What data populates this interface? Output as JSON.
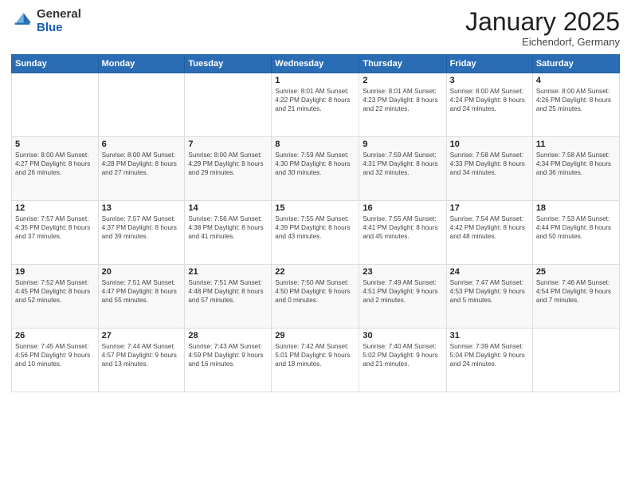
{
  "logo": {
    "general": "General",
    "blue": "Blue"
  },
  "header": {
    "title": "January 2025",
    "subtitle": "Eichendorf, Germany"
  },
  "days_of_week": [
    "Sunday",
    "Monday",
    "Tuesday",
    "Wednesday",
    "Thursday",
    "Friday",
    "Saturday"
  ],
  "weeks": [
    [
      {
        "day": "",
        "text": ""
      },
      {
        "day": "",
        "text": ""
      },
      {
        "day": "",
        "text": ""
      },
      {
        "day": "1",
        "text": "Sunrise: 8:01 AM\nSunset: 4:22 PM\nDaylight: 8 hours and 21 minutes."
      },
      {
        "day": "2",
        "text": "Sunrise: 8:01 AM\nSunset: 4:23 PM\nDaylight: 8 hours and 22 minutes."
      },
      {
        "day": "3",
        "text": "Sunrise: 8:00 AM\nSunset: 4:24 PM\nDaylight: 8 hours and 24 minutes."
      },
      {
        "day": "4",
        "text": "Sunrise: 8:00 AM\nSunset: 4:26 PM\nDaylight: 8 hours and 25 minutes."
      }
    ],
    [
      {
        "day": "5",
        "text": "Sunrise: 8:00 AM\nSunset: 4:27 PM\nDaylight: 8 hours and 26 minutes."
      },
      {
        "day": "6",
        "text": "Sunrise: 8:00 AM\nSunset: 4:28 PM\nDaylight: 8 hours and 27 minutes."
      },
      {
        "day": "7",
        "text": "Sunrise: 8:00 AM\nSunset: 4:29 PM\nDaylight: 8 hours and 29 minutes."
      },
      {
        "day": "8",
        "text": "Sunrise: 7:59 AM\nSunset: 4:30 PM\nDaylight: 8 hours and 30 minutes."
      },
      {
        "day": "9",
        "text": "Sunrise: 7:59 AM\nSunset: 4:31 PM\nDaylight: 8 hours and 32 minutes."
      },
      {
        "day": "10",
        "text": "Sunrise: 7:58 AM\nSunset: 4:33 PM\nDaylight: 8 hours and 34 minutes."
      },
      {
        "day": "11",
        "text": "Sunrise: 7:58 AM\nSunset: 4:34 PM\nDaylight: 8 hours and 36 minutes."
      }
    ],
    [
      {
        "day": "12",
        "text": "Sunrise: 7:57 AM\nSunset: 4:35 PM\nDaylight: 8 hours and 37 minutes."
      },
      {
        "day": "13",
        "text": "Sunrise: 7:57 AM\nSunset: 4:37 PM\nDaylight: 8 hours and 39 minutes."
      },
      {
        "day": "14",
        "text": "Sunrise: 7:56 AM\nSunset: 4:38 PM\nDaylight: 8 hours and 41 minutes."
      },
      {
        "day": "15",
        "text": "Sunrise: 7:55 AM\nSunset: 4:39 PM\nDaylight: 8 hours and 43 minutes."
      },
      {
        "day": "16",
        "text": "Sunrise: 7:55 AM\nSunset: 4:41 PM\nDaylight: 8 hours and 45 minutes."
      },
      {
        "day": "17",
        "text": "Sunrise: 7:54 AM\nSunset: 4:42 PM\nDaylight: 8 hours and 48 minutes."
      },
      {
        "day": "18",
        "text": "Sunrise: 7:53 AM\nSunset: 4:44 PM\nDaylight: 8 hours and 50 minutes."
      }
    ],
    [
      {
        "day": "19",
        "text": "Sunrise: 7:52 AM\nSunset: 4:45 PM\nDaylight: 8 hours and 52 minutes."
      },
      {
        "day": "20",
        "text": "Sunrise: 7:51 AM\nSunset: 4:47 PM\nDaylight: 8 hours and 55 minutes."
      },
      {
        "day": "21",
        "text": "Sunrise: 7:51 AM\nSunset: 4:48 PM\nDaylight: 8 hours and 57 minutes."
      },
      {
        "day": "22",
        "text": "Sunrise: 7:50 AM\nSunset: 4:50 PM\nDaylight: 9 hours and 0 minutes."
      },
      {
        "day": "23",
        "text": "Sunrise: 7:49 AM\nSunset: 4:51 PM\nDaylight: 9 hours and 2 minutes."
      },
      {
        "day": "24",
        "text": "Sunrise: 7:47 AM\nSunset: 4:53 PM\nDaylight: 9 hours and 5 minutes."
      },
      {
        "day": "25",
        "text": "Sunrise: 7:46 AM\nSunset: 4:54 PM\nDaylight: 9 hours and 7 minutes."
      }
    ],
    [
      {
        "day": "26",
        "text": "Sunrise: 7:45 AM\nSunset: 4:56 PM\nDaylight: 9 hours and 10 minutes."
      },
      {
        "day": "27",
        "text": "Sunrise: 7:44 AM\nSunset: 4:57 PM\nDaylight: 9 hours and 13 minutes."
      },
      {
        "day": "28",
        "text": "Sunrise: 7:43 AM\nSunset: 4:59 PM\nDaylight: 9 hours and 16 minutes."
      },
      {
        "day": "29",
        "text": "Sunrise: 7:42 AM\nSunset: 5:01 PM\nDaylight: 9 hours and 18 minutes."
      },
      {
        "day": "30",
        "text": "Sunrise: 7:40 AM\nSunset: 5:02 PM\nDaylight: 9 hours and 21 minutes."
      },
      {
        "day": "31",
        "text": "Sunrise: 7:39 AM\nSunset: 5:04 PM\nDaylight: 9 hours and 24 minutes."
      },
      {
        "day": "",
        "text": ""
      }
    ]
  ]
}
